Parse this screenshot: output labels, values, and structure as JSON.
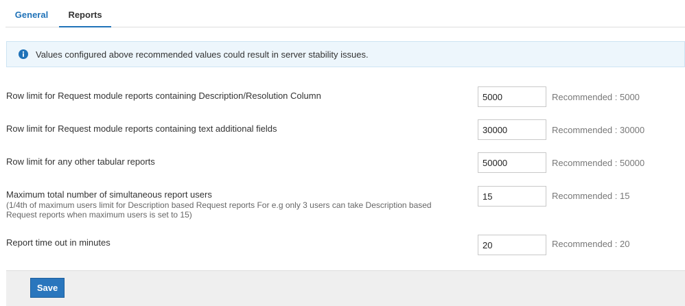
{
  "tabs": [
    {
      "label": "General",
      "active": false
    },
    {
      "label": "Reports",
      "active": true
    }
  ],
  "info": {
    "icon": "info-icon",
    "message": "Values configured above recommended values could result in server stability issues."
  },
  "settings": [
    {
      "label": "Row limit for Request module reports containing Description/Resolution Column",
      "value": "5000",
      "recommended": "Recommended : 5000"
    },
    {
      "label": "Row limit for Request module reports containing text additional fields",
      "value": "30000",
      "recommended": "Recommended : 30000"
    },
    {
      "label": "Row limit for any other tabular reports",
      "value": "50000",
      "recommended": "Recommended : 50000"
    },
    {
      "label": "Maximum total number of simultaneous report users",
      "sublabel": "(1/4th of maximum users limit for Description based Request reports For e.g only 3 users can take Description based Request reports when maximum users is set to 15)",
      "value": "15",
      "recommended": "Recommended : 15"
    },
    {
      "label": "Report time out in minutes",
      "value": "20",
      "recommended": "Recommended : 20"
    }
  ],
  "footer": {
    "save_label": "Save"
  },
  "colors": {
    "accent": "#1f72b8",
    "info_bg": "#edf6fc",
    "button": "#2a76bd"
  }
}
